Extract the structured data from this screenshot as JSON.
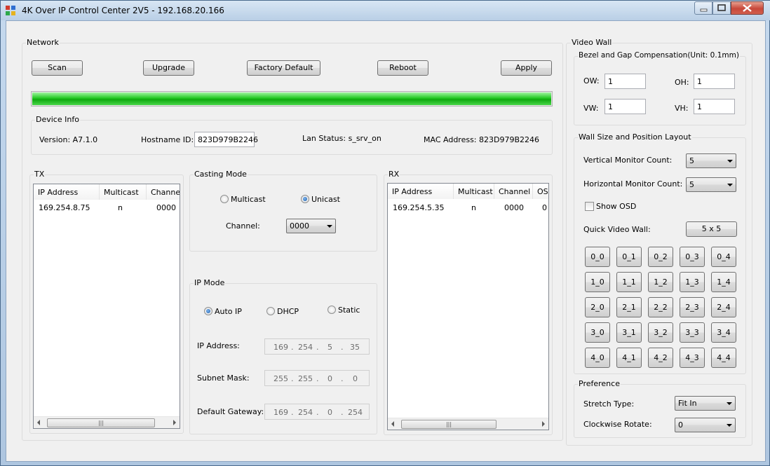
{
  "window": {
    "title": "4K Over IP Control Center 2V5 - 192.168.20.166",
    "controls": {
      "minimize_icon": "minimize-icon",
      "maximize_icon": "maximize-icon",
      "close_icon": "close-icon"
    }
  },
  "network": {
    "title": "Network",
    "buttons": {
      "scan": "Scan",
      "upgrade": "Upgrade",
      "factory_default": "Factory Default",
      "reboot": "Reboot",
      "apply": "Apply"
    },
    "progress": 1.0
  },
  "device_info": {
    "title": "Device Info",
    "version": "Version: A7.1.0",
    "hostname_label": "Hostname ID:",
    "hostname_value": "823D979B2246",
    "lan_status": "Lan Status: s_srv_on",
    "mac_address": "MAC Address: 823D979B2246"
  },
  "tx": {
    "title": "TX",
    "columns": [
      "IP Address",
      "Multicast",
      "Channe"
    ],
    "rows": [
      [
        "169.254.8.75",
        "n",
        "0000"
      ]
    ]
  },
  "casting_mode": {
    "title": "Casting Mode",
    "multicast_label": "Multicast",
    "unicast_label": "Unicast",
    "selected": "Unicast",
    "channel_label": "Channel:",
    "channel_value": "0000"
  },
  "ip_mode": {
    "title": "IP Mode",
    "options": [
      "Auto IP",
      "DHCP",
      "Static"
    ],
    "selected": "Auto IP",
    "ip_address_label": "IP Address:",
    "ip_address": [
      "169",
      "254",
      "5",
      "35"
    ],
    "subnet_mask_label": "Subnet Mask:",
    "subnet_mask": [
      "255",
      "255",
      "0",
      "0"
    ],
    "default_gateway_label": "Default Gateway:",
    "default_gateway": [
      "169",
      "254",
      "0",
      "254"
    ]
  },
  "rx": {
    "title": "RX",
    "columns": [
      "IP Address",
      "Multicast",
      "Channel",
      "OS"
    ],
    "rows": [
      [
        "169.254.5.35",
        "n",
        "0000",
        "0"
      ]
    ]
  },
  "video_wall": {
    "title": "Video Wall",
    "bezel": {
      "title": "Bezel and Gap Compensation(Unit: 0.1mm)",
      "ow_label": "OW:",
      "ow": "1",
      "oh_label": "OH:",
      "oh": "1",
      "vw_label": "VW:",
      "vw": "1",
      "vh_label": "VH:",
      "vh": "1"
    },
    "layout": {
      "title": "Wall Size and Position Layout",
      "vertical_label": "Vertical Monitor Count:",
      "vertical_value": "5",
      "horizontal_label": "Horizontal Monitor Count:",
      "horizontal_value": "5",
      "show_osd_label": "Show OSD",
      "show_osd_checked": false,
      "quick_label": "Quick Video Wall:",
      "quick_button": "5 x 5",
      "grid": [
        [
          "0_0",
          "0_1",
          "0_2",
          "0_3",
          "0_4"
        ],
        [
          "1_0",
          "1_1",
          "1_2",
          "1_3",
          "1_4"
        ],
        [
          "2_0",
          "2_1",
          "2_2",
          "2_3",
          "2_4"
        ],
        [
          "3_0",
          "3_1",
          "3_2",
          "3_3",
          "3_4"
        ],
        [
          "4_0",
          "4_1",
          "4_2",
          "4_3",
          "4_4"
        ]
      ]
    },
    "preference": {
      "title": "Preference",
      "stretch_label": "Stretch Type:",
      "stretch_value": "Fit In",
      "rotate_label": "Clockwise Rotate:",
      "rotate_value": "0"
    }
  },
  "colors": {
    "progress_fill": "#22c822",
    "radio_dot": "#1c5ca8",
    "close_button": "#c7483a"
  }
}
